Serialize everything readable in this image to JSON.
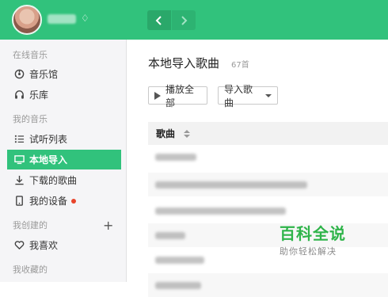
{
  "header": {
    "user": {
      "name": ""
    },
    "nav": {
      "back_icon": "chevron-left-icon",
      "forward_icon": "chevron-right-icon"
    }
  },
  "sidebar": {
    "sections": [
      {
        "title": "在线音乐",
        "items": [
          {
            "label": "音乐馆",
            "icon": "music-disc-icon"
          },
          {
            "label": "乐库",
            "icon": "headphones-icon"
          }
        ]
      },
      {
        "title": "我的音乐",
        "items": [
          {
            "label": "试听列表",
            "icon": "list-icon"
          },
          {
            "label": "本地导入",
            "icon": "monitor-icon",
            "active": true
          },
          {
            "label": "下载的歌曲",
            "icon": "download-icon"
          },
          {
            "label": "我的设备",
            "icon": "device-icon",
            "badge_dot": true
          }
        ]
      },
      {
        "title": "我创建的",
        "items": [
          {
            "label": "我喜欢",
            "icon": "heart-icon"
          }
        ]
      },
      {
        "title": "我收藏的",
        "items": []
      }
    ]
  },
  "main": {
    "title": "本地导入歌曲",
    "count": "67首",
    "buttons": {
      "play_all": "播放全部",
      "import": "导入歌曲"
    },
    "table": {
      "column_song": "歌曲",
      "rows": 7
    }
  },
  "watermark": {
    "title": "百科全说",
    "subtitle": "助你轻松解决"
  },
  "colors": {
    "accent": "#31c27c",
    "sidebar_bg": "#f5f5f7",
    "badge": "#e8442b"
  }
}
